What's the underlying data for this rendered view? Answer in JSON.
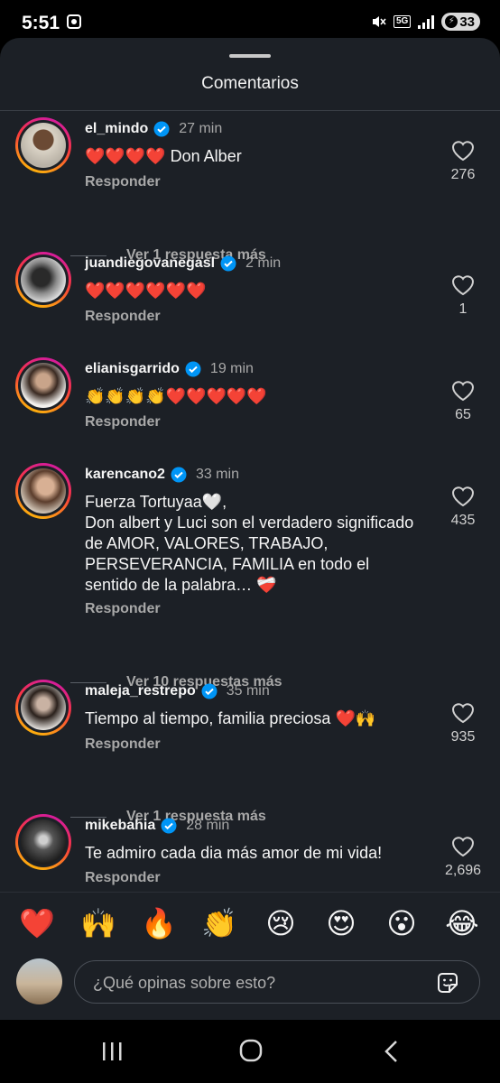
{
  "status_bar": {
    "time": "5:51",
    "network": "5G",
    "battery": "33"
  },
  "sheet": {
    "title": "Comentarios"
  },
  "comments": [
    {
      "username": "el_mindo",
      "verified": true,
      "time": "27 min",
      "text": "❤️❤️❤️❤️ Don Alber",
      "reply_label": "Responder",
      "likes": "276",
      "more_replies": "Ver 1 respuesta más"
    },
    {
      "username": "juandiegovanegasl",
      "verified": true,
      "time": "2 min",
      "text": "❤️❤️❤️❤️❤️❤️",
      "reply_label": "Responder",
      "likes": "1"
    },
    {
      "username": "elianisgarrido",
      "verified": true,
      "time": "19 min",
      "text": "👏👏👏👏❤️❤️❤️❤️❤️",
      "reply_label": "Responder",
      "likes": "65"
    },
    {
      "username": "karencano2",
      "verified": true,
      "time": "33 min",
      "text": "Fuerza Tortuyaa🤍,\nDon albert y Luci son el verdadero significado de AMOR, VALORES, TRABAJO, PERSEVERANCIA, FAMILIA en todo el sentido de la palabra… ❤️‍🩹",
      "reply_label": "Responder",
      "likes": "435",
      "more_replies": "Ver 10 respuestas más"
    },
    {
      "username": "maleja_restrepo",
      "verified": true,
      "time": "35 min",
      "text": "Tiempo al tiempo, familia preciosa ❤️🙌",
      "reply_label": "Responder",
      "likes": "935",
      "more_replies": "Ver 1 respuesta más"
    },
    {
      "username": "mikebahia",
      "verified": true,
      "time": "28 min",
      "text": "Te admiro cada dia más amor de mi vida!",
      "reply_label": "Responder",
      "likes": "2,696"
    }
  ],
  "quick_reactions": [
    "❤️",
    "🙌",
    "🔥",
    "👏",
    "😢",
    "😍",
    "😮",
    "😂"
  ],
  "composer": {
    "placeholder": "¿Qué opinas sobre esto?"
  },
  "colors": {
    "sheet_bg": "#1c2026",
    "verified": "#0095f6",
    "secondary_text": "#a8a8a8"
  },
  "icons": {
    "like": "heart-outline-icon",
    "verified": "verified-badge-icon",
    "sticker": "sticker-icon",
    "nav": [
      "recent-apps-icon",
      "home-icon",
      "back-icon"
    ]
  }
}
